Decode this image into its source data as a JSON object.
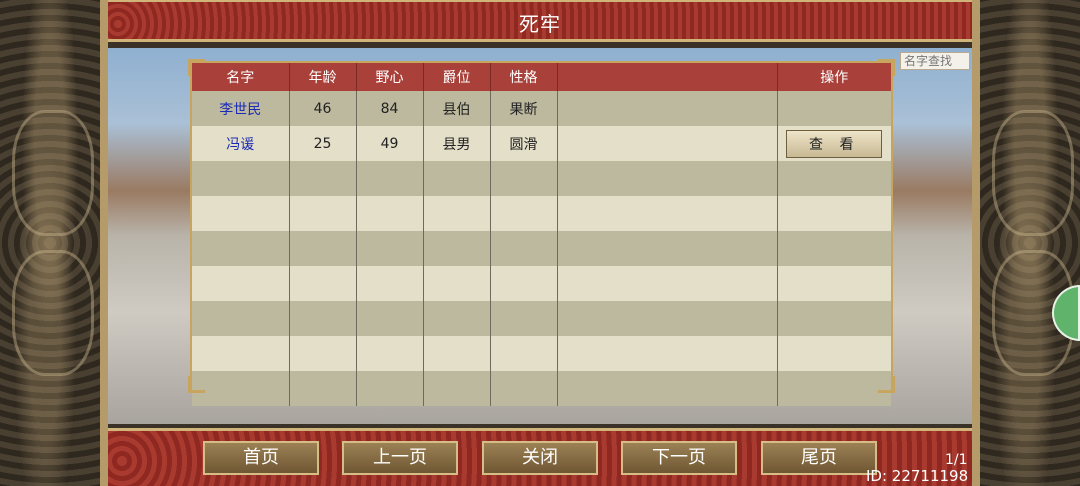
{
  "window": {
    "title": "死牢"
  },
  "search": {
    "placeholder": "名字查找"
  },
  "table": {
    "headers": [
      "名字",
      "年龄",
      "野心",
      "爵位",
      "性格",
      "",
      "操作"
    ],
    "rows": [
      {
        "name": "李世民",
        "age": "46",
        "ambition": "84",
        "rank": "县伯",
        "personality": "果断",
        "extra": "",
        "action": ""
      },
      {
        "name": "冯谖",
        "age": "25",
        "ambition": "49",
        "rank": "县男",
        "personality": "圆滑",
        "extra": "",
        "action": "查 看"
      }
    ],
    "empty_rows": 7
  },
  "footer": {
    "buttons": [
      "首页",
      "上一页",
      "关闭",
      "下一页",
      "尾页"
    ],
    "page_indicator": "1/1",
    "id_text": "ID: 22711198"
  }
}
